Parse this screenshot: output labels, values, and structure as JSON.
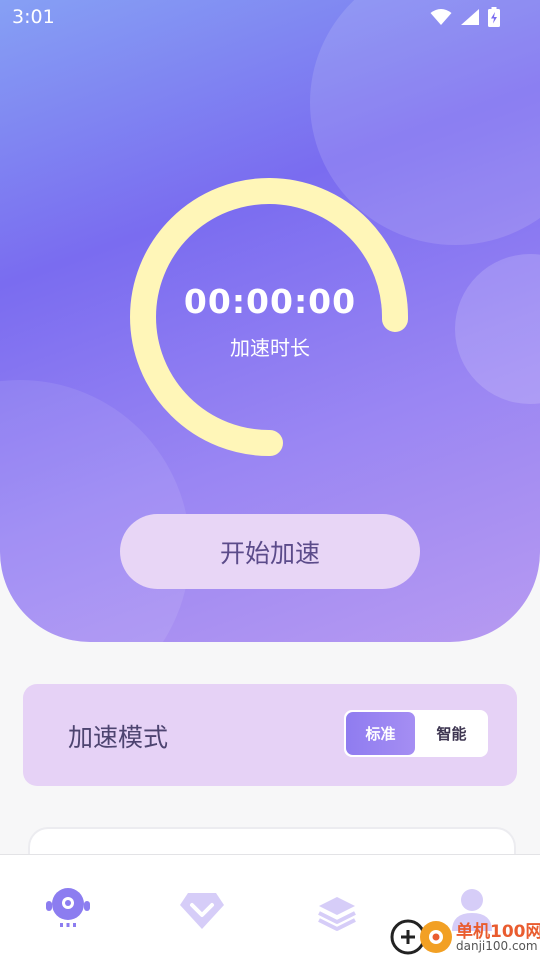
{
  "status_bar": {
    "time": "3:01",
    "icons": [
      "wifi-icon",
      "signal-icon",
      "battery-charging-icon"
    ]
  },
  "accelerator": {
    "timer": "00:00:00",
    "timer_label": "加速时长",
    "start_button": "开始加速"
  },
  "mode": {
    "title": "加速模式",
    "options": [
      "标准",
      "智能"
    ],
    "selected": "标准"
  },
  "tabbar": {
    "items": [
      "robot-icon",
      "diamond-icon",
      "layers-icon",
      "user-icon"
    ],
    "active_index": 0
  },
  "watermark": {
    "title": "单机100网",
    "subtitle": "danji100.com"
  },
  "colors": {
    "gradient_start": "#86a0f4",
    "gradient_mid": "#7a6cf0",
    "gradient_end": "#b79af1",
    "ring": "#fff6b8",
    "button_bg": "#e8d6f6",
    "button_text": "#5b4b8a",
    "card_bg": "#e6d2f6",
    "tab_active": "#8c7df0",
    "tab_inactive": "#d6cdf8"
  }
}
